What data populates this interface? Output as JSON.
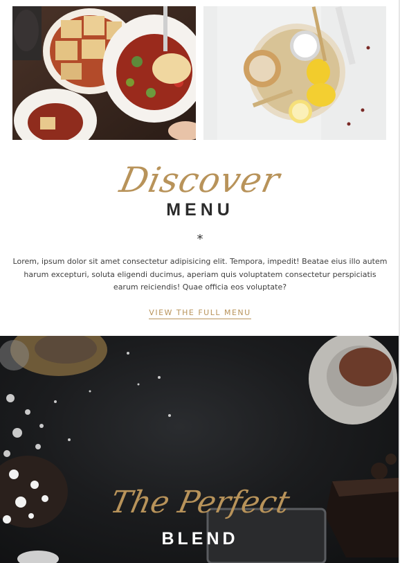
{
  "discover_section": {
    "script_word": "Discover",
    "title": "MENU",
    "divider_symbol": "*",
    "description": "Lorem, ipsum dolor sit amet consectetur adipisicing elit. Tempora, impedit! Beatae eius illo autem harum excepturi, soluta eligendi ducimus, aperiam quis voluptatem consectetur perspiciatis earum reiciendis! Quae officia eos voluptate?",
    "link_label": "VIEW THE FULL MENU"
  },
  "blend_section": {
    "script_phrase": "The Perfect",
    "title": "BLEND"
  },
  "colors": {
    "accent_gold": "#b8935a",
    "heading_dark": "#2b2b2b",
    "hero_background": "#1b1c1e"
  }
}
